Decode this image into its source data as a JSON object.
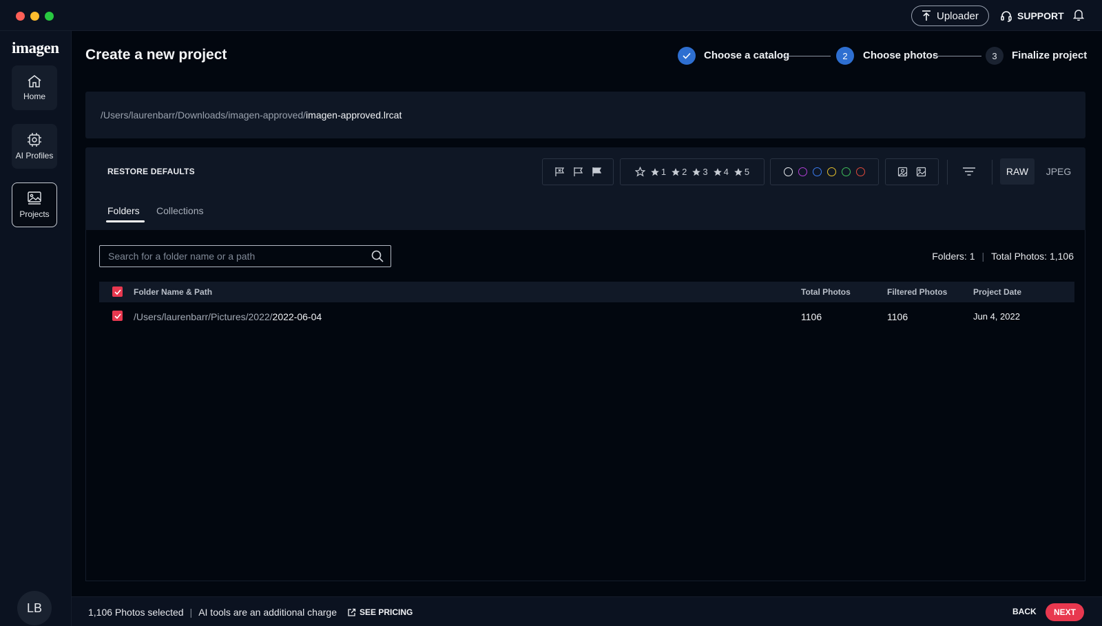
{
  "titlebar": {
    "uploader_label": "Uploader",
    "support_label": "SUPPORT"
  },
  "sidebar": {
    "logo": "imagen",
    "items": [
      {
        "label": "Home",
        "icon": "home-icon"
      },
      {
        "label": "AI Profiles",
        "icon": "ai-chip-icon"
      },
      {
        "label": "Projects",
        "icon": "image-gallery-icon",
        "active": true
      }
    ],
    "avatar_initials": "LB"
  },
  "header": {
    "title": "Create a new project",
    "steps": [
      {
        "number": "✓",
        "label": "Choose a catalog",
        "state": "done"
      },
      {
        "number": "2",
        "label": "Choose photos",
        "state": "current"
      },
      {
        "number": "3",
        "label": "Finalize project",
        "state": "pending"
      }
    ]
  },
  "catalog": {
    "path_dir": "/Users/laurenbarr/Downloads/imagen-approved/",
    "path_file": "imagen-approved.lrcat"
  },
  "filters": {
    "restore_label": "RESTORE DEFAULTS",
    "star_labels": [
      "1",
      "2",
      "3",
      "4",
      "5"
    ],
    "color_labels": [
      "#e6e8ec",
      "#b23fd6",
      "#3b7cf0",
      "#e8c22c",
      "#3fbf5a",
      "#e24a3b"
    ],
    "format_raw": "RAW",
    "format_jpeg": "JPEG",
    "tabs": [
      "Folders",
      "Collections"
    ]
  },
  "folders": {
    "search_placeholder": "Search for a folder name or a path",
    "count_folders": "Folders: 1",
    "count_photos": "Total Photos: 1,106",
    "columns": [
      "Folder Name & Path",
      "Total Photos",
      "Filtered Photos",
      "Project Date"
    ],
    "rows": [
      {
        "path_dir": "/Users/laurenbarr/Pictures/2022/",
        "path_name": "2022-06-04",
        "total": "1106",
        "filtered": "1106",
        "date": "Jun 4, 2022"
      }
    ]
  },
  "footer": {
    "selected": "1,106 Photos selected",
    "ai_note": "AI tools are an additional charge",
    "pricing_label": "SEE PRICING",
    "back_label": "BACK",
    "next_label": "NEXT"
  },
  "colors": {
    "accent": "#e8384f",
    "step_blue": "#2e6fd1",
    "background": "#02070f",
    "panel": "#0f1725"
  }
}
